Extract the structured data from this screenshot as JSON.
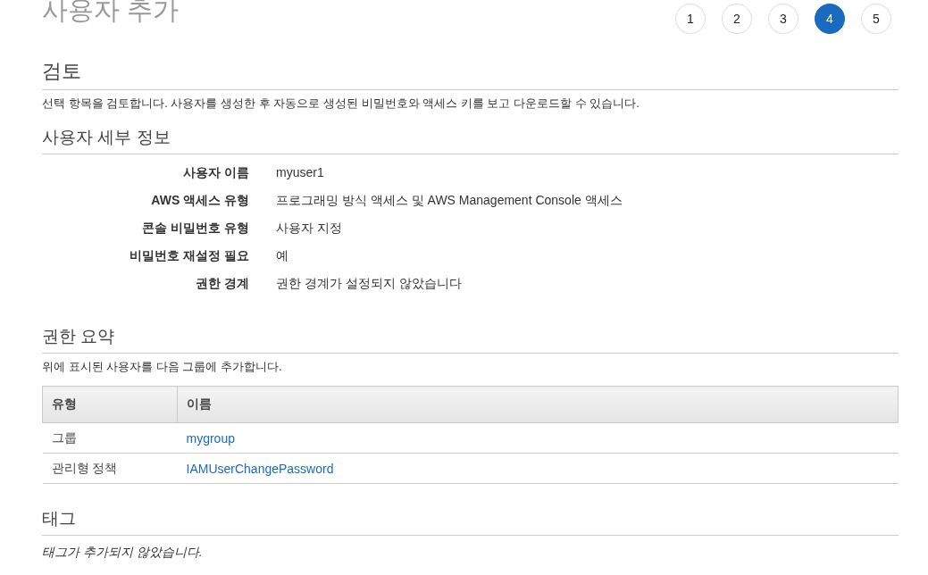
{
  "page_title": "사용자 추가",
  "steps": [
    {
      "label": "1",
      "selected": false
    },
    {
      "label": "2",
      "selected": false
    },
    {
      "label": "3",
      "selected": false
    },
    {
      "label": "4",
      "selected": true
    },
    {
      "label": "5",
      "selected": false
    }
  ],
  "review": {
    "heading": "검토",
    "description": "선택 항목을 검토합니다. 사용자를 생성한 후 자동으로 생성된 비밀번호와 액세스 키를 보고 다운로드할 수 있습니다."
  },
  "user_details": {
    "heading": "사용자 세부 정보",
    "rows": [
      {
        "label": "사용자 이름",
        "value": "myuser1"
      },
      {
        "label": "AWS 액세스 유형",
        "value": "프로그래밍 방식 액세스 및 AWS Management Console 액세스"
      },
      {
        "label": "콘솔 비밀번호 유형",
        "value": "사용자 지정"
      },
      {
        "label": "비밀번호 재설정 필요",
        "value": "예"
      },
      {
        "label": "권한 경계",
        "value": "권한 경계가 설정되지 않았습니다"
      }
    ]
  },
  "permissions": {
    "heading": "권한 요약",
    "description": "위에 표시된 사용자를 다음 그룹에 추가합니다.",
    "table": {
      "columns": [
        "유형",
        "이름"
      ],
      "rows": [
        {
          "type": "그룹",
          "name": "mygroup"
        },
        {
          "type": "관리형 정책",
          "name": "IAMUserChangePassword"
        }
      ]
    }
  },
  "tags": {
    "heading": "태그",
    "empty_text": "태그가 추가되지 않았습니다."
  }
}
